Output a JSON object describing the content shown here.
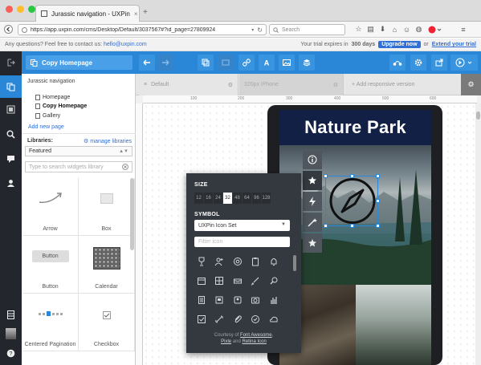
{
  "browser": {
    "tab_title": "Jurassic navigation - UXPin",
    "url": "https://app.uxpin.com/cms/Desktop/Default/3037567#?id_page=27809924",
    "search_placeholder": "Search"
  },
  "notice": {
    "question": "Any questions? Feel free to contact us:",
    "email": "hello@uxpin.com",
    "trial_prefix": "Your trial expires in",
    "trial_days": "300 days",
    "upgrade": "Upgrade now",
    "or": "or",
    "extend": "Extend your trial"
  },
  "toolbar": {
    "copy_label": "Copy Homepage"
  },
  "pages": {
    "project": "Jurassic navigation",
    "items": [
      "Homepage",
      "Copy Homepage",
      "Gallery"
    ],
    "add_label": "Add new page"
  },
  "libraries": {
    "label": "Libraries:",
    "manage": "manage libraries",
    "selected": "Featured",
    "search_placeholder": "Type to search widgets library",
    "widgets": [
      "Arrow",
      "Box",
      "Button",
      "Calendar",
      "Centered Pagination",
      "Checkbox"
    ],
    "button_preview": "Button"
  },
  "canvas": {
    "tabs": [
      "Default",
      "320px  iPhone",
      "+ Add responsive version"
    ],
    "ruler_marks": [
      "100",
      "200",
      "300",
      "400",
      "500",
      "600"
    ]
  },
  "phone": {
    "title": "Nature Park"
  },
  "picker": {
    "size_label": "SIZE",
    "sizes": [
      "12",
      "16",
      "24",
      "32",
      "48",
      "64",
      "96",
      "128"
    ],
    "selected_size": "32",
    "symbol_label": "SYMBOL",
    "icon_set": "UXPin Icon Set",
    "filter_placeholder": "Filter icon",
    "credit_line1": "Courtesy of",
    "credit_link1": "Font Awesome",
    "credit_comma": ",",
    "credit_link2": "Pixle",
    "credit_and": "and",
    "credit_link3": "Retina Icon",
    "icons": [
      "trophy-icon",
      "person-add-icon",
      "at-icon",
      "clipboard-icon",
      "bell-icon",
      "calendar-icon",
      "grid-icon",
      "inbox-icon",
      "brush-icon",
      "search-icon",
      "document-icon",
      "box-icon",
      "users-icon",
      "camera-icon",
      "bar-chart-icon",
      "checkbox-icon",
      "link-icon",
      "paperclip-icon",
      "check-circle-icon",
      "cloud-icon"
    ]
  },
  "colors": {
    "toolbar": "#2a87d8",
    "rail": "#23262c",
    "picker": "#34393f",
    "link": "#2f6fd6"
  }
}
